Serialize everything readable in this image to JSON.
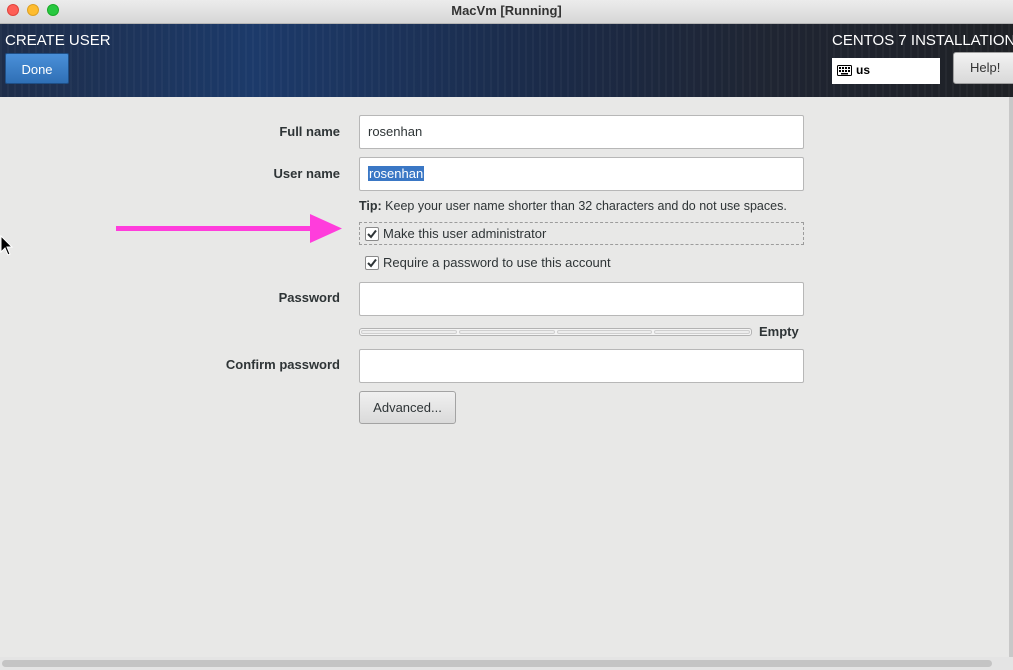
{
  "window": {
    "title": "MacVm [Running]"
  },
  "header": {
    "page_title": "CREATE USER",
    "done_label": "Done",
    "installer_title": "CENTOS 7 INSTALLATION",
    "keyboard_layout": "us",
    "help_label": "Help!"
  },
  "form": {
    "full_name_label": "Full name",
    "full_name_value": "rosenhan",
    "user_name_label": "User name",
    "user_name_value": "rosenhan",
    "tip_bold": "Tip:",
    "tip_text": " Keep your user name shorter than 32 characters and do not use spaces.",
    "admin_checkbox_label": "Make this user administrator",
    "admin_checked": true,
    "require_password_label": "Require a password to use this account",
    "require_password_checked": true,
    "password_label": "Password",
    "password_value": "",
    "password_strength_label": "Empty",
    "password_strength_level": 0,
    "confirm_password_label": "Confirm password",
    "confirm_password_value": "",
    "advanced_label": "Advanced..."
  },
  "colors": {
    "accent": "#3a77c5",
    "annotation_arrow": "#ff3ddc"
  },
  "icons": [
    "keyboard-icon",
    "checkmark-icon",
    "arrow-annotation-icon",
    "mouse-pointer-icon"
  ]
}
